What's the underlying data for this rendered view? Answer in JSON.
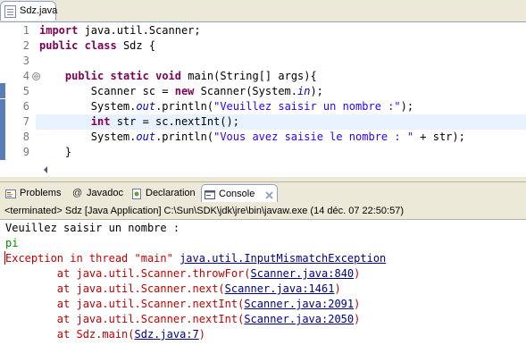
{
  "editor": {
    "tab_label": "Sdz.java",
    "line_numbers": [
      "1",
      "2",
      "3",
      "4",
      "5",
      "6",
      "7",
      "8",
      "9"
    ],
    "fold_marker": "⊖",
    "lines": {
      "l1": {
        "kw": "import",
        "rest": " java.util.Scanner;"
      },
      "l2": {
        "kw1": "public",
        "sp": " ",
        "kw2": "class",
        "rest": " Sdz {"
      },
      "l4": {
        "indent": "    ",
        "kw1": "public",
        "kw2": "static",
        "kw3": "void",
        "rest": " main(String[] args){"
      },
      "l5": {
        "a": "        Scanner sc = ",
        "kw": "new",
        "b": " Scanner(System.",
        "ital": "in",
        "c": ");"
      },
      "l6": {
        "a": "        System.",
        "ital": "out",
        "b": ".println(",
        "str": "\"Veuillez saisir un nombre :\"",
        "c": ");"
      },
      "l7": {
        "indent": "        ",
        "kw": "int",
        "rest": " str = sc.nextInt();"
      },
      "l8": {
        "a": "        System.",
        "ital": "out",
        "b": ".println(",
        "str": "\"Vous avez saisie le nombre : \"",
        "c": " + str);"
      },
      "l9": {
        "text": "    }"
      }
    }
  },
  "views": {
    "tabs": [
      {
        "label": "Problems",
        "icon": "problems-icon"
      },
      {
        "label": "Javadoc",
        "icon": "javadoc-icon"
      },
      {
        "label": "Declaration",
        "icon": "declaration-icon"
      },
      {
        "label": "Console",
        "icon": "console-icon"
      }
    ],
    "active_tab": "Console"
  },
  "console": {
    "status": "<terminated> Sdz [Java Application] C:\\Sun\\SDK\\jdk\\jre\\bin\\javaw.exe (14 déc. 07 22:50:57)",
    "output_line": "Veuillez saisir un nombre :",
    "input_line": "pi",
    "exception_prefix": "Exception in thread \"main\" ",
    "exception_link": "java.util.InputMismatchException",
    "stack": [
      {
        "prefix": "        at java.util.Scanner.throwFor(",
        "link": "Scanner.java:840",
        "suffix": ")"
      },
      {
        "prefix": "        at java.util.Scanner.next(",
        "link": "Scanner.java:1461",
        "suffix": ")"
      },
      {
        "prefix": "        at java.util.Scanner.nextInt(",
        "link": "Scanner.java:2091",
        "suffix": ")"
      },
      {
        "prefix": "        at java.util.Scanner.nextInt(",
        "link": "Scanner.java:2050",
        "suffix": ")"
      },
      {
        "prefix": "        at Sdz.main(",
        "link": "Sdz.java:7",
        "suffix": ")"
      }
    ]
  },
  "colors": {
    "keyword": "#7f0055",
    "string": "#2a00ff",
    "static_field": "#0000c0",
    "error": "#c00000",
    "user_input": "#009000",
    "current_line": "#e8f2fe"
  }
}
